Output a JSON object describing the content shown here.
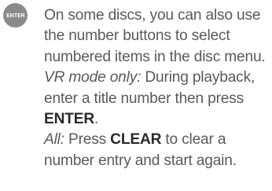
{
  "icon": {
    "name": "enter-button-icon",
    "label": "ENTER",
    "color": "#8a8a8a"
  },
  "paragraph1": "On some discs, you can also use the number buttons to select numbered items in the disc menu.",
  "paragraph2": {
    "label": "VR mode only:",
    "text": " During playback, enter a title number then press ",
    "key": "ENTER",
    "end": "."
  },
  "paragraph3": {
    "label": "All:",
    "text_before": " Press ",
    "key": "CLEAR",
    "text_after": " to clear a number entry and start again."
  }
}
